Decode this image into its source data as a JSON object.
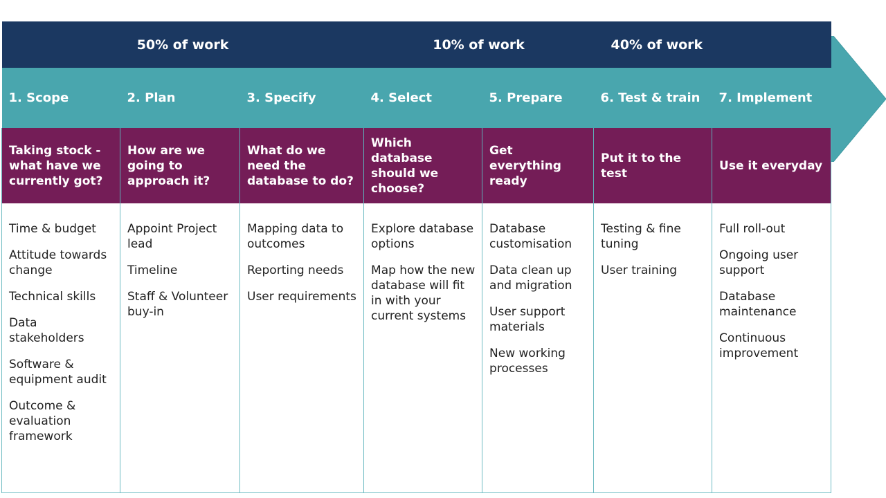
{
  "colors": {
    "navy": "#1b3861",
    "teal": "#49a6ae",
    "purple": "#741d57",
    "body_border": "#6dbbc2"
  },
  "work_share": [
    {
      "label": "50% of work",
      "phases": [
        "1",
        "2",
        "3"
      ]
    },
    {
      "label": "10% of work",
      "phases": [
        "4",
        "5"
      ]
    },
    {
      "label": "40% of work",
      "phases": [
        "6",
        "7"
      ]
    }
  ],
  "phases": [
    {
      "title": "1. Scope",
      "question": "Taking stock - what have we currently got?",
      "tasks": [
        "Time & budget",
        "Attitude towards change",
        "Technical skills",
        "Data stakeholders",
        "Software & equipment audit",
        "Outcome & evaluation framework"
      ]
    },
    {
      "title": "2. Plan",
      "question": "How are we going to approach it?",
      "tasks": [
        "Appoint Project lead",
        "Timeline",
        "Staff & Volunteer buy-in"
      ]
    },
    {
      "title": "3. Specify",
      "question": "What do we need the database to do?",
      "tasks": [
        "Mapping data to outcomes",
        "Reporting needs",
        "User requirements"
      ]
    },
    {
      "title": "4. Select",
      "question": "Which database should we choose?",
      "tasks": [
        "Explore database options",
        "Map how the new database will fit in with your current systems"
      ]
    },
    {
      "title": "5. Prepare",
      "question": "Get everything ready",
      "tasks": [
        "Database customisation",
        "Data clean up and migration",
        "User support materials",
        "New working processes"
      ]
    },
    {
      "title": "6. Test & train",
      "question": "Put it to the test",
      "tasks": [
        "Testing & fine tuning",
        "User training"
      ]
    },
    {
      "title": "7. Implement",
      "question": "Use it everyday",
      "tasks": [
        "Full roll-out",
        "Ongoing user support",
        "Database maintenance",
        "Continuous improvement"
      ]
    }
  ]
}
